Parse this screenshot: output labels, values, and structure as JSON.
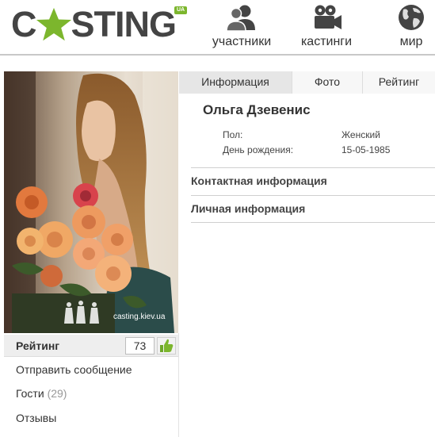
{
  "header": {
    "logo_before": "C",
    "logo_after": "STING",
    "logo_badge": "UA",
    "nav": [
      {
        "label": "участники",
        "icon": "people-icon"
      },
      {
        "label": "кастинги",
        "icon": "movie-camera-icon"
      },
      {
        "label": "мир",
        "icon": "globe-icon"
      }
    ]
  },
  "photo": {
    "watermark": "casting.kiev.ua"
  },
  "sidebar": {
    "rating_label": "Рейтинг",
    "rating_count": "73",
    "send_message": "Отправить сообщение",
    "guests_label": "Гости",
    "guests_count": "(29)",
    "reviews": "Отзывы"
  },
  "tabs": [
    "Информация",
    "Фото",
    "Рейтинг"
  ],
  "profile": {
    "name": "Ольга Дзевенис",
    "fields": [
      {
        "label": "Пол:",
        "value": "Женский"
      },
      {
        "label": "День рождения:",
        "value": "15-05-1985"
      }
    ],
    "sections": [
      "Контактная информация",
      "Личная информация"
    ]
  },
  "colors": {
    "accent_green": "#7cb62d",
    "logo_gray": "#444444"
  }
}
